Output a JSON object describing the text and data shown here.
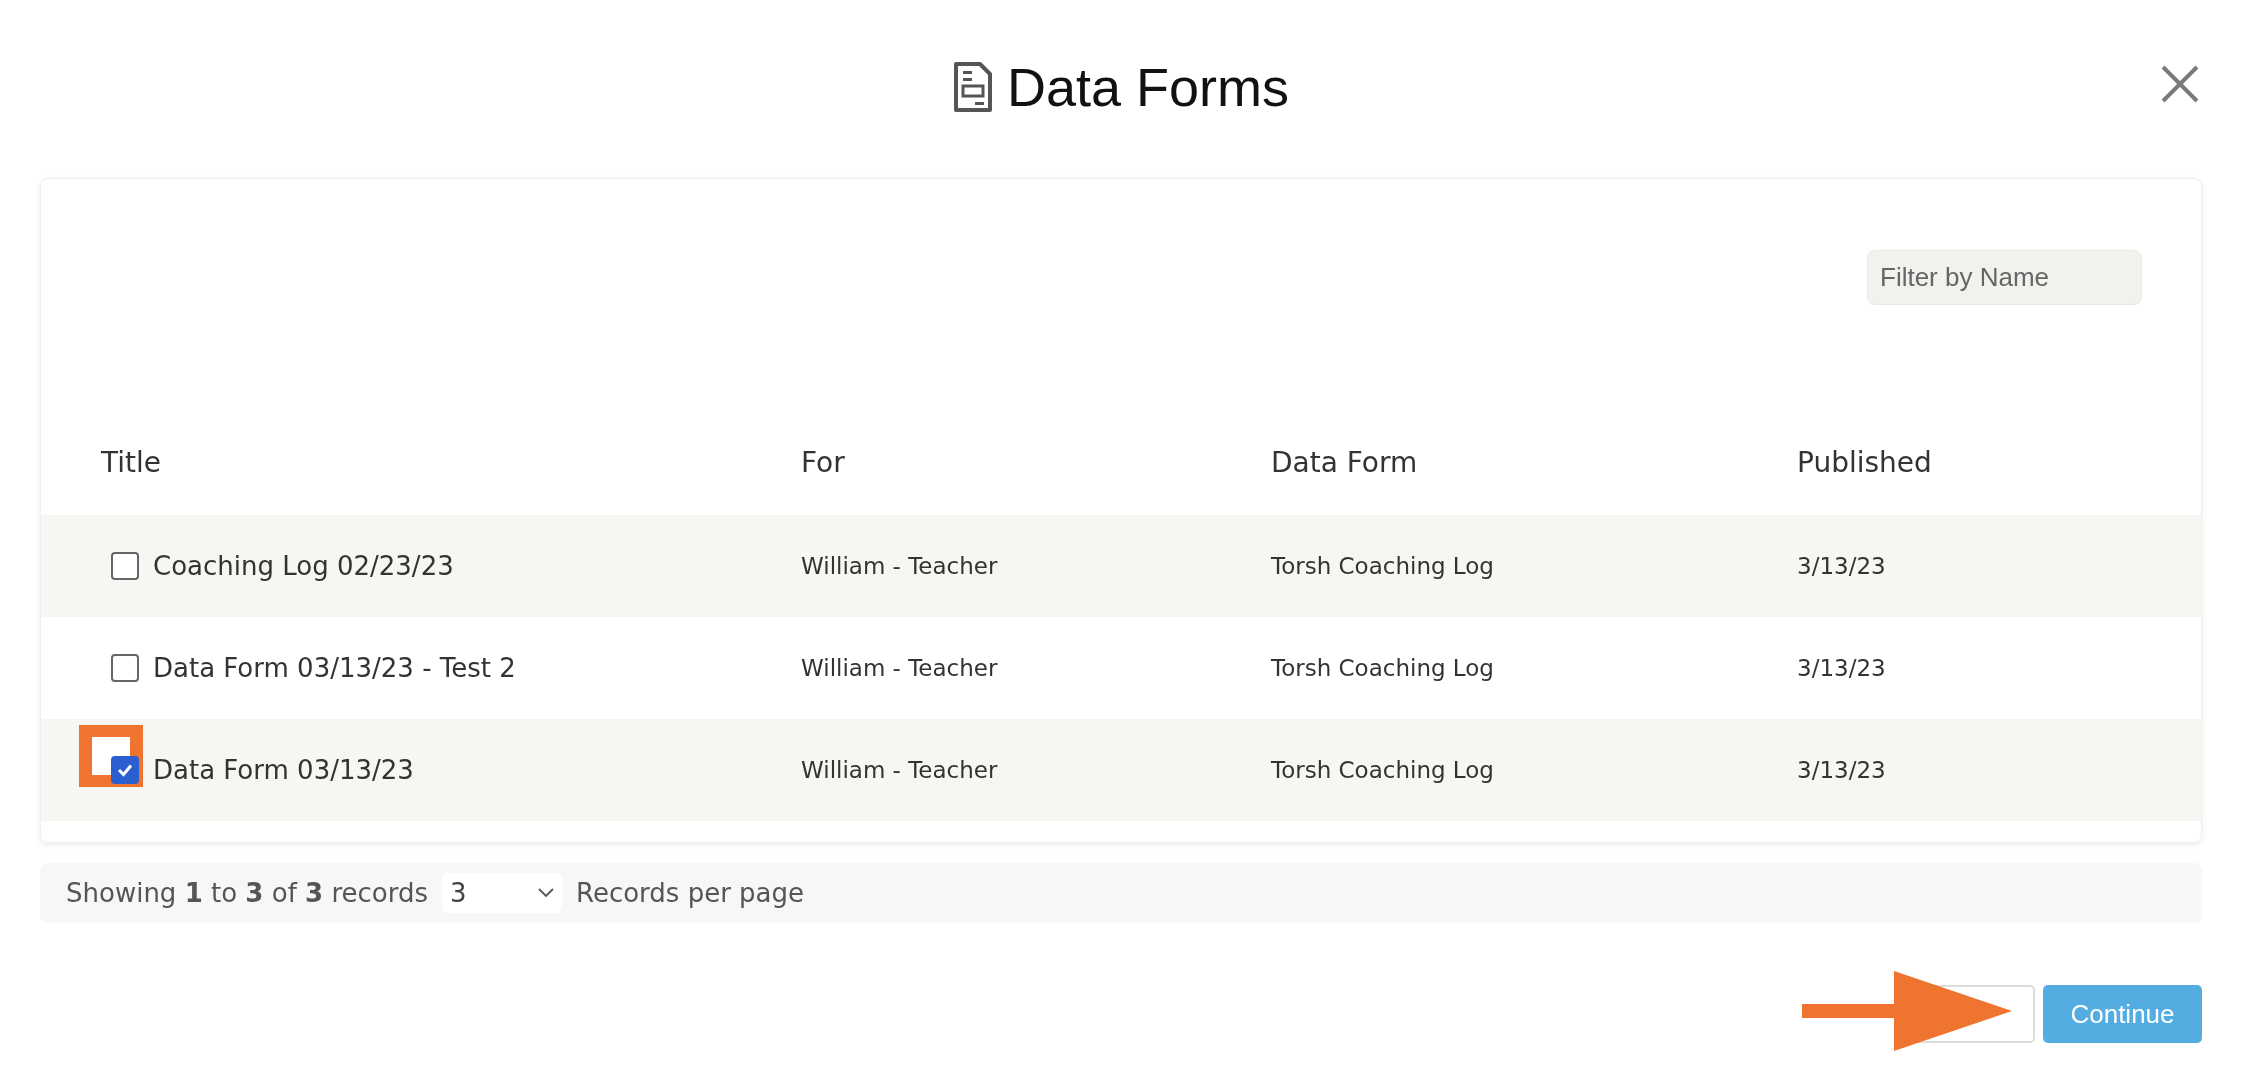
{
  "dialog": {
    "title": "Data Forms"
  },
  "filter": {
    "placeholder": "Filter by Name"
  },
  "table": {
    "columns": [
      "Title",
      "For",
      "Data Form",
      "Published"
    ],
    "rows": [
      {
        "checked": false,
        "highlighted": false,
        "cells": [
          "Coaching Log 02/23/23",
          "William - Teacher",
          "Torsh Coaching Log",
          "3/13/23"
        ]
      },
      {
        "checked": false,
        "highlighted": false,
        "cells": [
          "Data Form 03/13/23 - Test 2",
          "William - Teacher",
          "Torsh Coaching Log",
          "3/13/23"
        ]
      },
      {
        "checked": true,
        "highlighted": true,
        "cells": [
          "Data Form 03/13/23",
          "William - Teacher",
          "Torsh Coaching Log",
          "3/13/23"
        ]
      }
    ]
  },
  "footer": {
    "summary": "Showing **1** to **3** of **3** records",
    "per_page": "3",
    "per_page_label": "Records per page"
  },
  "buttons": [
    {
      "kind": "secondary"
    },
    {
      "label": "Continue",
      "kind": "primary"
    }
  ]
}
